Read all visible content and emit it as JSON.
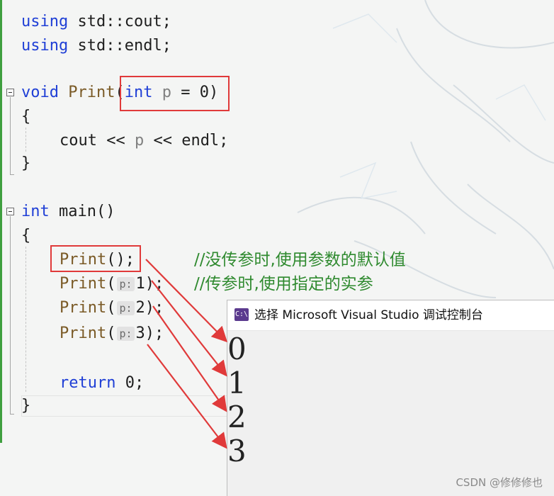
{
  "editor": {
    "line_using_cout": {
      "kw": "using",
      "rest": " std::cout;"
    },
    "line_using_endl": {
      "kw": "using",
      "rest": " std::endl;"
    },
    "line_print_decl": {
      "kw_void": "void",
      "fn": " Print",
      "open": "(",
      "kw_int": "int",
      "param": " p",
      "rest": " = 0)"
    },
    "brace_open_1": "{",
    "line_cout": {
      "a": "cout << ",
      "p": "p",
      "b": " << endl;"
    },
    "brace_close_1": "}",
    "line_main": {
      "kw": "int",
      "rest": " main()"
    },
    "brace_open_2": "{",
    "line_call_0": {
      "fn": "Print",
      "rest": "();",
      "comment": "//没传参时,使用参数的默认值"
    },
    "line_call_1": {
      "fn": "Print",
      "open": "(",
      "hint": "p:",
      "rest": "1);",
      "comment": "//传参时,使用指定的实参"
    },
    "line_call_2": {
      "fn": "Print",
      "open": "(",
      "hint": "p:",
      "rest": "2);"
    },
    "line_call_3": {
      "fn": "Print",
      "open": "(",
      "hint": "p:",
      "rest": "3);"
    },
    "line_return": {
      "kw": "return",
      "rest": " 0;"
    },
    "brace_close_2": "}"
  },
  "console": {
    "icon_text": "C:\\",
    "title": "选择 Microsoft Visual Studio 调试控制台",
    "output": [
      "0",
      "1",
      "2",
      "3"
    ]
  },
  "watermark": "CSDN @修修修也",
  "colors": {
    "keyword": "#1f3fd6",
    "function": "#7a5a26",
    "parameter": "#808080",
    "comment": "#2f8a2f",
    "highlight": "#e03a3a"
  }
}
